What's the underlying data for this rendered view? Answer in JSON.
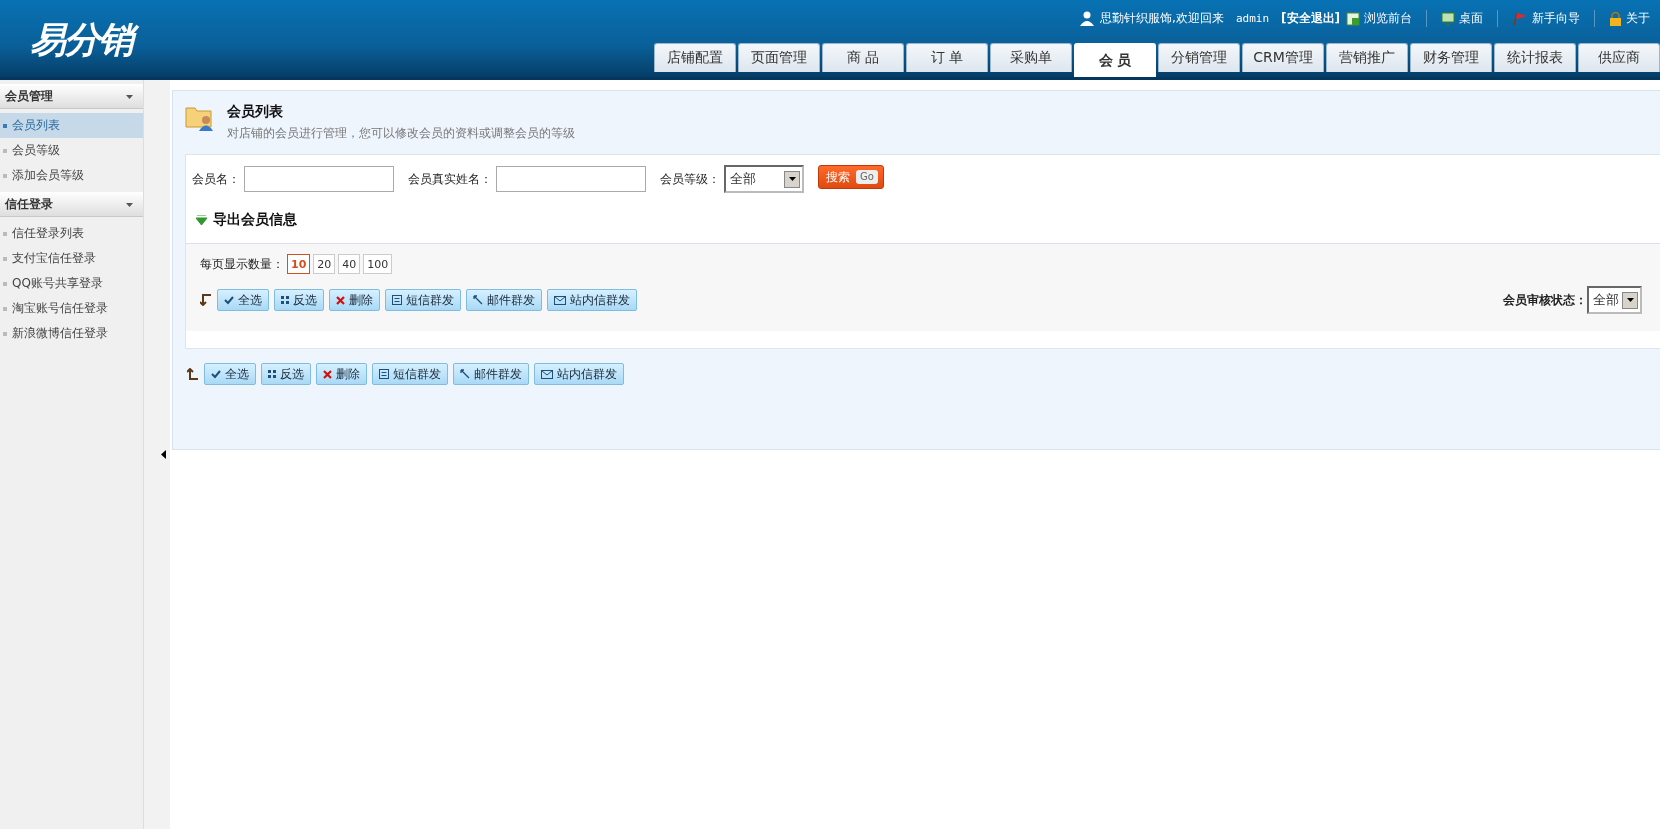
{
  "logo": "易分销",
  "header": {
    "greeting": "思勤针织服饰,欢迎回来",
    "username": "admin",
    "logout": "[安全退出]",
    "links": [
      {
        "kind": "browse",
        "label": "浏览前台"
      },
      {
        "kind": "desktop",
        "label": "桌面"
      },
      {
        "kind": "guide",
        "label": "新手向导"
      },
      {
        "kind": "about",
        "label": "关于"
      }
    ]
  },
  "tabs": [
    {
      "label": "店铺配置",
      "selected": false
    },
    {
      "label": "页面管理",
      "selected": false
    },
    {
      "label": "商 品",
      "selected": false
    },
    {
      "label": "订 单",
      "selected": false
    },
    {
      "label": "采购单",
      "selected": false
    },
    {
      "label": "会 员",
      "selected": true
    },
    {
      "label": "分销管理",
      "selected": false
    },
    {
      "label": "CRM管理",
      "selected": false
    },
    {
      "label": "营销推广",
      "selected": false
    },
    {
      "label": "财务管理",
      "selected": false
    },
    {
      "label": "统计报表",
      "selected": false
    },
    {
      "label": "供应商",
      "selected": false
    }
  ],
  "sidebar": {
    "groups": [
      {
        "title": "会员管理",
        "expanded": true,
        "items": [
          {
            "label": "会员列表",
            "selected": true
          },
          {
            "label": "会员等级",
            "selected": false
          },
          {
            "label": "添加会员等级",
            "selected": false
          }
        ]
      },
      {
        "title": "信任登录",
        "expanded": true,
        "items": [
          {
            "label": "信任登录列表",
            "selected": false
          },
          {
            "label": "支付宝信任登录",
            "selected": false
          },
          {
            "label": "QQ账号共享登录",
            "selected": false
          },
          {
            "label": "淘宝账号信任登录",
            "selected": false
          },
          {
            "label": "新浪微博信任登录",
            "selected": false
          }
        ]
      }
    ]
  },
  "page": {
    "title": "会员列表",
    "subtitle": "对店铺的会员进行管理，您可以修改会员的资料或调整会员的等级"
  },
  "search": {
    "fields": [
      {
        "label": "会员名："
      },
      {
        "label": "会员真实姓名："
      }
    ],
    "grade": {
      "label": "会员等级：",
      "value": "全部"
    },
    "button": "搜索",
    "button_tag": "Go"
  },
  "export": "导出会员信息",
  "page_size": {
    "label": "每页显示数量：",
    "options": [
      {
        "label": "10",
        "selected": true
      },
      {
        "label": "20",
        "selected": false
      },
      {
        "label": "40",
        "selected": false
      },
      {
        "label": "100",
        "selected": false
      }
    ]
  },
  "actions_top": [
    {
      "kind": "check",
      "label": "全选"
    },
    {
      "kind": "invert",
      "label": "反选"
    },
    {
      "kind": "delete",
      "label": "删除"
    },
    {
      "kind": "sms",
      "label": "短信群发"
    },
    {
      "kind": "mail",
      "label": "邮件群发"
    },
    {
      "kind": "message",
      "label": "站内信群发"
    }
  ],
  "status_filter": {
    "label": "会员审核状态：",
    "value": "全部"
  },
  "actions_bottom": [
    {
      "kind": "check",
      "label": "全选"
    },
    {
      "kind": "invert",
      "label": "反选"
    },
    {
      "kind": "delete",
      "label": "删除"
    },
    {
      "kind": "sms",
      "label": "短信群发"
    },
    {
      "kind": "mail",
      "label": "邮件群发"
    },
    {
      "kind": "message",
      "label": "站内信群发"
    }
  ]
}
